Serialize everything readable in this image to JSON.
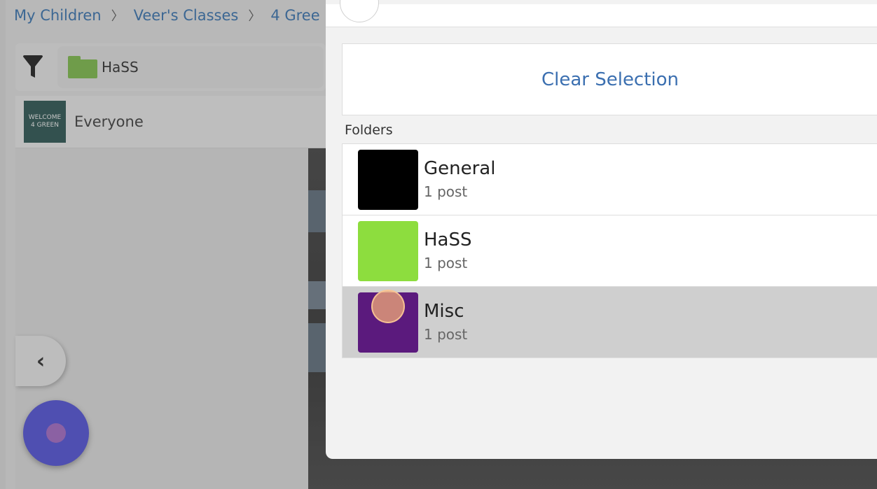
{
  "breadcrumb": {
    "items": [
      "My Children",
      "Veer's Classes",
      "4 Gree"
    ]
  },
  "filter_bar": {
    "folder_label": "HaSS",
    "folder_color": "#7bc142"
  },
  "class_row": {
    "thumb_line1": "WELCOME",
    "thumb_line2": "4 GREEN",
    "name": "Everyone"
  },
  "panel": {
    "clear_selection_label": "Clear Selection",
    "folders_heading": "Folders",
    "folders": [
      {
        "name": "General",
        "count": "1 post",
        "color": "#000000"
      },
      {
        "name": "HaSS",
        "count": "1 post",
        "color": "#8ddd3e"
      },
      {
        "name": "Misc",
        "count": "1 post",
        "color": "#5b1a7d",
        "selected": true
      }
    ]
  },
  "colors": {
    "link_blue": "#3b6fb0",
    "fab_blue": "#4a4ae0"
  }
}
